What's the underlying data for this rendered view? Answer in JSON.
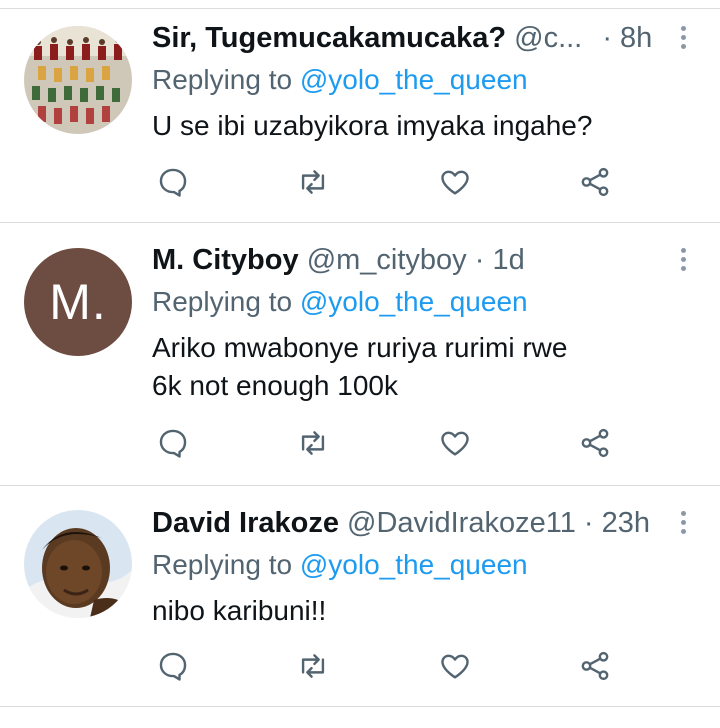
{
  "tweets": [
    {
      "name": "Sir, Tugemucakamucaka?",
      "handle": "@c...",
      "dot": "·",
      "time": "8h",
      "replying_prefix": "Replying to",
      "replying_handle": "@yolo_the_queen",
      "text_lines": [
        "U se ibi uzabyikora imyaka ingahe?"
      ],
      "avatar": {
        "type": "photo-group",
        "bg": "#cfc8b8"
      }
    },
    {
      "name": "M. Cityboy",
      "handle": "@m_cityboy",
      "dot": "·",
      "time": "1d",
      "replying_prefix": "Replying to",
      "replying_handle": "@yolo_the_queen",
      "text_lines": [
        "Ariko mwabonye ruriya rurimi rwe",
        "6k not enough 100k"
      ],
      "avatar": {
        "type": "initial",
        "initial": "M.",
        "bg": "#6d4c41"
      }
    },
    {
      "name": "David Irakoze",
      "handle": "@DavidIrakoze11",
      "dot": "·",
      "time": "23h",
      "replying_prefix": "Replying to",
      "replying_handle": "@yolo_the_queen",
      "text_lines": [
        "nibo karibuni!!"
      ],
      "avatar": {
        "type": "photo-face",
        "bg": "#d9e6f2"
      }
    }
  ],
  "actions": [
    "reply-icon",
    "retweet-icon",
    "like-icon",
    "share-icon"
  ],
  "colors": {
    "link": "#1d9bf0",
    "secondary": "#536471",
    "icon": "#536471",
    "primary_text": "#0f1419"
  }
}
